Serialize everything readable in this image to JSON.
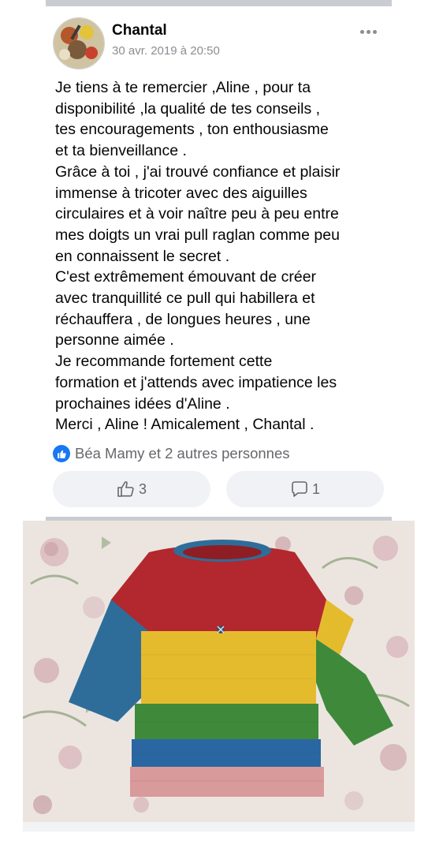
{
  "post": {
    "author": "Chantal",
    "date": "30 avr. 2019 à 20:50",
    "text_lines": [
      "Je tiens à te remercier ,Aline , pour ta",
      "disponibilité ,la qualité de tes conseils ,",
      "tes encouragements , ton enthousiasme",
      "et ta bienveillance .",
      "Grâce à toi , j'ai trouvé confiance et plaisir",
      "immense à tricoter avec des aiguilles",
      "circulaires et à voir naître peu à peu entre",
      "mes doigts un vrai pull raglan comme peu",
      "en connaissent le secret .",
      "C'est extrêmement émouvant de créer",
      "avec tranquillité ce pull qui habillera et",
      "réchauffera , de longues heures , une",
      "personne aimée .",
      "Je recommande fortement cette",
      "formation et j'attends avec impatience les",
      "prochaines idées d'Aline .",
      "Merci , Aline ! Amicalement , Chantal ."
    ],
    "reactions_text": "Béa Mamy et 2 autres personnes",
    "like_count": "3",
    "comment_count": "1"
  },
  "icons": {
    "like_badge": "thumbs-up-icon",
    "like_button": "thumbs-up-outline-icon",
    "comment_button": "comment-bubble-icon",
    "more": "more-horizontal-icon"
  },
  "colors": {
    "brand": "#1877f2",
    "secondary_text": "#65676b",
    "button_bg": "#f0f2f5",
    "sweater_stripes": [
      "#2e6d9a",
      "#b3272e",
      "#e5bb2e",
      "#3f8a3a",
      "#2a67a2",
      "#d99a9c"
    ]
  }
}
